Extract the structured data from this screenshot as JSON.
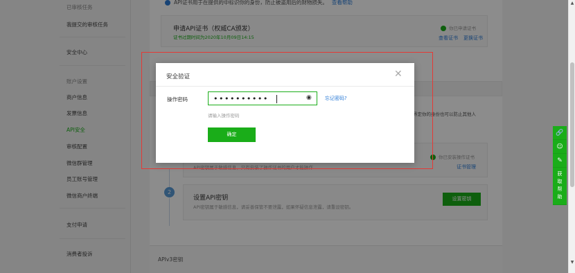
{
  "sidebar": {
    "items": [
      {
        "label": "已审核任务",
        "state": "muted"
      },
      {
        "label": "我提交的审核任务",
        "state": "normal"
      },
      {
        "label": "安全中心",
        "state": "normal"
      },
      {
        "label": "账户设置",
        "state": "muted"
      },
      {
        "label": "商户信息",
        "state": "normal"
      },
      {
        "label": "发票信息",
        "state": "normal"
      },
      {
        "label": "API安全",
        "state": "active"
      },
      {
        "label": "审核配置",
        "state": "normal"
      },
      {
        "label": "微信群管理",
        "state": "normal"
      },
      {
        "label": "员工账号管理",
        "state": "normal"
      },
      {
        "label": "微信商户终端",
        "state": "normal"
      },
      {
        "label": "支付申请",
        "state": "normal"
      },
      {
        "label": "消费者投诉",
        "state": "normal"
      }
    ]
  },
  "main": {
    "notice_text": "API证书用于在提供的中标识你的身份，防止被盗用后的财物损失。",
    "notice_link": "查看帮助",
    "cert_card": {
      "title": "申请API证书（权威CA颁发）",
      "sub": "证书过期时间为2020年10月09日14:15",
      "status": "你已申请证书",
      "link_view": "查看证书",
      "link_update": "更换证书"
    },
    "partial_text": "界定你的身份也可以防止其他人",
    "pwd_card": {
      "sub": "API密钥属于敏感信息，只有安装了操作证书的用户才能操作",
      "status": "你已安装操作证书",
      "link": "证书管理"
    },
    "key_card": {
      "step": "2",
      "title": "设置API密钥",
      "sub": "API密钥属于敏感信息，请妥善保管不要泄露，如果怀疑信息泄露，请重设密钥。",
      "button": "设置密钥"
    },
    "apiv3_label": "APIv3密钥"
  },
  "help_tabs": {
    "icons": [
      "link-icon",
      "person-icon",
      "edit-icon"
    ],
    "help_label": "获取帮助"
  },
  "modal": {
    "title": "安全验证",
    "field_label": "操作密码",
    "password_mask": "••••••••••",
    "forgot_link": "忘记密码?",
    "hint": "请输入操作密码",
    "confirm": "确定"
  },
  "colors": {
    "accent": "#1aad19",
    "link": "#2b7bd6",
    "highlight": "#e53935"
  }
}
